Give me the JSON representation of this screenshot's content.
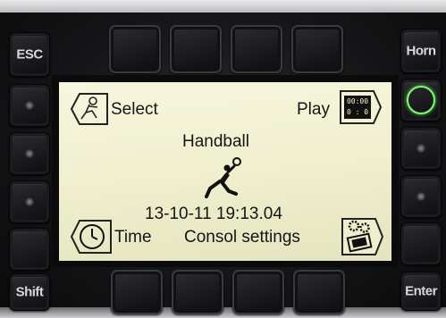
{
  "buttons": {
    "esc_label": "ESC",
    "horn_label": "Horn",
    "shift_label": "Shift",
    "enter_label": "Enter"
  },
  "screen": {
    "select_label": "Select",
    "play_label": "Play",
    "scoreboard_time": "00:00",
    "scoreboard_score": "0 : 0",
    "sport": "Handball",
    "datetime": "13-10-11 19:13.04",
    "time_label": "Time",
    "settings_label": "Consol settings"
  },
  "colors": {
    "screen_bg": "#efeecc",
    "led_green": "#7cff6a",
    "key_dark": "#1c1c20"
  }
}
